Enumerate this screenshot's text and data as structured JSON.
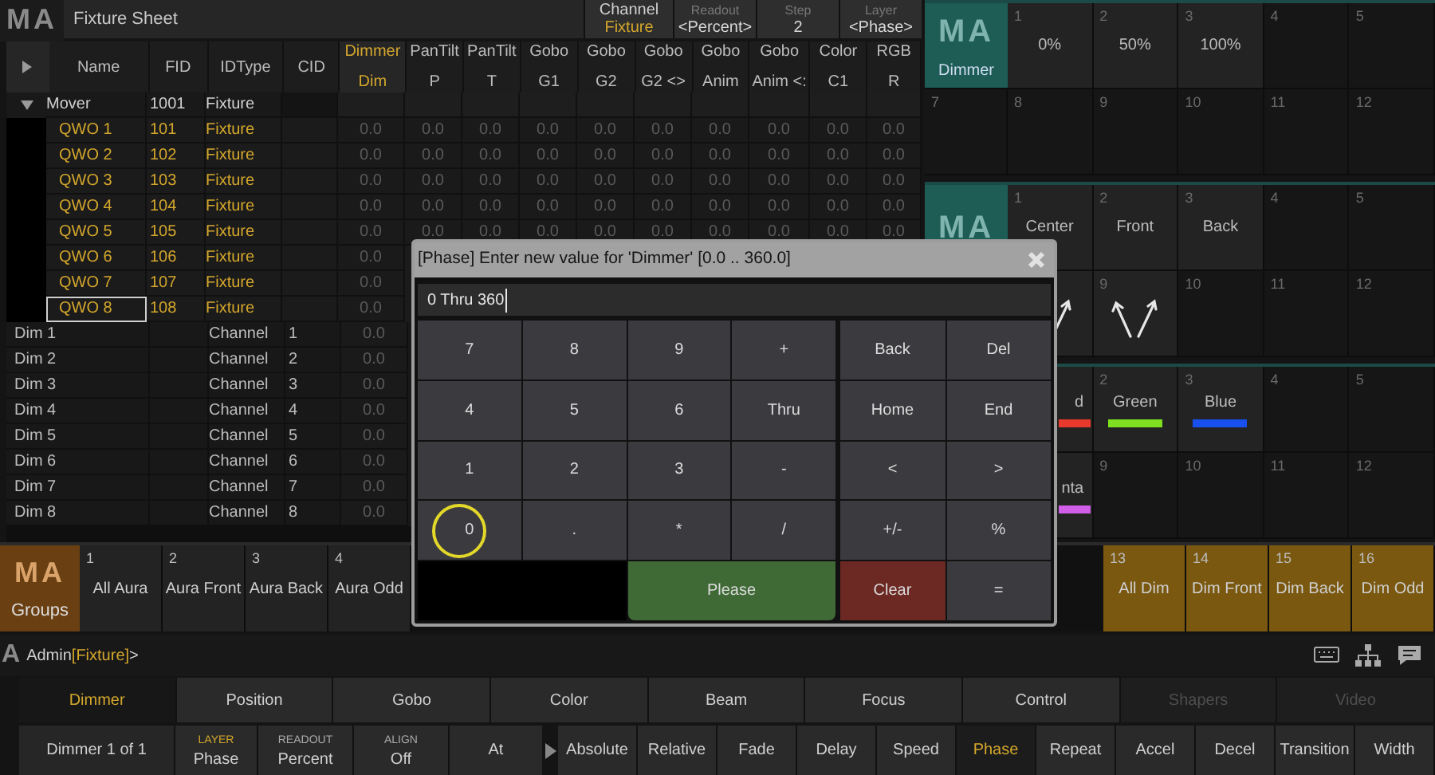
{
  "sheet": {
    "logo": "MA",
    "title": "Fixture Sheet",
    "header_fields": [
      {
        "kind": "mode",
        "label": "Channel",
        "value": "Fixture"
      },
      {
        "kind": "field",
        "label": "Readout",
        "value": "<Percent>"
      },
      {
        "kind": "field",
        "label": "Step",
        "value": "2"
      },
      {
        "kind": "field",
        "label": "Layer",
        "value": "<Phase>"
      }
    ],
    "table": {
      "columns": [
        {
          "title": "Name",
          "selected": false
        },
        {
          "title": "FID",
          "selected": false
        },
        {
          "title": "IDType",
          "selected": false
        },
        {
          "title": "CID",
          "selected": false
        },
        {
          "title": "Dimmer",
          "attribute": "Dim",
          "selected": true
        },
        {
          "title": "PanTilt",
          "attribute": "P",
          "selected": false
        },
        {
          "title": "PanTilt",
          "attribute": "T",
          "selected": false
        },
        {
          "title": "Gobo",
          "attribute": "G1",
          "selected": false
        },
        {
          "title": "Gobo",
          "attribute": "G2",
          "selected": false
        },
        {
          "title": "Gobo",
          "attribute": "G2 <>",
          "selected": false
        },
        {
          "title": "Gobo",
          "attribute": "Anim",
          "selected": false
        },
        {
          "title": "Gobo",
          "attribute": "Anim <:",
          "selected": false
        },
        {
          "title": "Color",
          "attribute": "C1",
          "selected": false
        },
        {
          "title": "RGB",
          "attribute": "R",
          "selected": false
        }
      ],
      "rows": [
        {
          "kind": "group",
          "name": "Mover",
          "fid": "1001",
          "idtype": "Fixture",
          "expanded": true
        },
        {
          "kind": "fixture",
          "name": "QWO 1",
          "fid": "101",
          "idtype": "Fixture",
          "selected": false,
          "values": [
            "0.0",
            "0.0",
            "0.0",
            "0.0",
            "0.0",
            "0.0",
            "0.0",
            "0.0",
            "0.0",
            "0.0"
          ]
        },
        {
          "kind": "fixture",
          "name": "QWO 2",
          "fid": "102",
          "idtype": "Fixture",
          "selected": false,
          "values": [
            "0.0",
            "0.0",
            "0.0",
            "0.0",
            "0.0",
            "0.0",
            "0.0",
            "0.0",
            "0.0",
            "0.0"
          ]
        },
        {
          "kind": "fixture",
          "name": "QWO 3",
          "fid": "103",
          "idtype": "Fixture",
          "selected": false,
          "values": [
            "0.0",
            "0.0",
            "0.0",
            "0.0",
            "0.0",
            "0.0",
            "0.0",
            "0.0",
            "0.0",
            "0.0"
          ]
        },
        {
          "kind": "fixture",
          "name": "QWO 4",
          "fid": "104",
          "idtype": "Fixture",
          "selected": false,
          "values": [
            "0.0",
            "0.0",
            "0.0",
            "0.0",
            "0.0",
            "0.0",
            "0.0",
            "0.0",
            "0.0",
            "0.0"
          ]
        },
        {
          "kind": "fixture",
          "name": "QWO 5",
          "fid": "105",
          "idtype": "Fixture",
          "selected": false,
          "values": [
            "0.0",
            "0.0",
            "0.0",
            "0.0",
            "0.0",
            "0.0",
            "0.0",
            "0.0",
            "0.0",
            "0.0"
          ]
        },
        {
          "kind": "fixture",
          "name": "QWO 6",
          "fid": "106",
          "idtype": "Fixture",
          "selected": false,
          "values": [
            "0.0"
          ]
        },
        {
          "kind": "fixture",
          "name": "QWO 7",
          "fid": "107",
          "idtype": "Fixture",
          "selected": false,
          "values": [
            "0.0"
          ]
        },
        {
          "kind": "fixture",
          "name": "QWO 8",
          "fid": "108",
          "idtype": "Fixture",
          "selected": true,
          "values": [
            "0.0"
          ]
        },
        {
          "kind": "channel",
          "name": "Dim 1",
          "idtype": "Channel",
          "cid": "1",
          "selected": false,
          "values": [
            "0.0"
          ]
        },
        {
          "kind": "channel",
          "name": "Dim 2",
          "idtype": "Channel",
          "cid": "2",
          "selected": false,
          "values": [
            "0.0"
          ]
        },
        {
          "kind": "channel",
          "name": "Dim 3",
          "idtype": "Channel",
          "cid": "3",
          "selected": false,
          "values": [
            "0.0"
          ]
        },
        {
          "kind": "channel",
          "name": "Dim 4",
          "idtype": "Channel",
          "cid": "4",
          "selected": false,
          "values": [
            "0.0"
          ]
        },
        {
          "kind": "channel",
          "name": "Dim 5",
          "idtype": "Channel",
          "cid": "5",
          "selected": false,
          "values": [
            "0.0"
          ]
        },
        {
          "kind": "channel",
          "name": "Dim 6",
          "idtype": "Channel",
          "cid": "6",
          "selected": false,
          "values": [
            "0.0"
          ]
        },
        {
          "kind": "channel",
          "name": "Dim 7",
          "idtype": "Channel",
          "cid": "7",
          "selected": false,
          "values": [
            "0.0"
          ]
        },
        {
          "kind": "channel",
          "name": "Dim 8",
          "idtype": "Channel",
          "cid": "8",
          "selected": false,
          "values": [
            "0.0"
          ]
        }
      ]
    }
  },
  "pools": [
    {
      "logo": "MA",
      "label": "Dimmer",
      "items": [
        {
          "kind": "preset",
          "number": "1",
          "label": "0%"
        },
        {
          "kind": "preset",
          "number": "2",
          "label": "50%"
        },
        {
          "kind": "preset",
          "number": "3",
          "label": "100%"
        },
        {
          "kind": "empty",
          "number": "4"
        },
        {
          "kind": "empty",
          "number": "5"
        },
        {
          "kind": "empty",
          "number": "7"
        },
        {
          "kind": "empty",
          "number": "8"
        },
        {
          "kind": "empty",
          "number": "9"
        },
        {
          "kind": "empty",
          "number": "10"
        },
        {
          "kind": "empty",
          "number": "11"
        },
        {
          "kind": "empty",
          "number": "12"
        }
      ]
    },
    {
      "logo": "MA",
      "items": [
        {
          "kind": "preset",
          "number": "1",
          "label": "Center"
        },
        {
          "kind": "preset",
          "number": "2",
          "label": "Front"
        },
        {
          "kind": "preset",
          "number": "3",
          "label": "Back"
        },
        {
          "kind": "empty",
          "number": "4"
        },
        {
          "kind": "empty",
          "number": "5"
        },
        {
          "kind": "covered"
        },
        {
          "kind": "arrows"
        },
        {
          "kind": "arrows",
          "number": "9"
        },
        {
          "kind": "empty",
          "number": "10"
        },
        {
          "kind": "empty",
          "number": "11"
        },
        {
          "kind": "empty",
          "number": "12"
        }
      ]
    },
    {
      "items": [
        {
          "kind": "color_clipped",
          "label": "d",
          "color": "#e8392c"
        },
        {
          "kind": "color",
          "number": "2",
          "label": "Green",
          "color": "#7ee021"
        },
        {
          "kind": "color",
          "number": "3",
          "label": "Blue",
          "color": "#1750ee"
        },
        {
          "kind": "empty",
          "number": "4"
        },
        {
          "kind": "empty",
          "number": "5"
        },
        {
          "kind": "covered"
        },
        {
          "kind": "color_clipped",
          "label": "nta",
          "color": "#d05ee8"
        },
        {
          "kind": "empty",
          "number": "9"
        },
        {
          "kind": "empty",
          "number": "10"
        },
        {
          "kind": "empty",
          "number": "11"
        },
        {
          "kind": "empty",
          "number": "12"
        }
      ]
    }
  ],
  "groups": {
    "logo": "MA",
    "label": "Groups",
    "left": [
      {
        "number": "1",
        "label": "All Aura",
        "selected": false
      },
      {
        "number": "2",
        "label": "Aura Front",
        "selected": false
      },
      {
        "number": "3",
        "label": "Aura Back",
        "selected": false
      },
      {
        "number": "4",
        "label": "Aura Odd",
        "selected": false
      }
    ],
    "right": [
      {
        "number": "13",
        "label": "All Dim",
        "selected": true
      },
      {
        "number": "14",
        "label": "Dim Front",
        "selected": true
      },
      {
        "number": "15",
        "label": "Dim Back",
        "selected": true
      },
      {
        "number": "16",
        "label": "Dim Odd",
        "selected": true
      }
    ]
  },
  "command_line": {
    "logo": "A",
    "user": "Admin",
    "context": "[Fixture]",
    "suffix": ">"
  },
  "feature_tabs": [
    {
      "label": "Dimmer",
      "selected": true,
      "disabled": false
    },
    {
      "label": "Position",
      "selected": false,
      "disabled": false
    },
    {
      "label": "Gobo",
      "selected": false,
      "disabled": false
    },
    {
      "label": "Color",
      "selected": false,
      "disabled": false
    },
    {
      "label": "Beam",
      "selected": false,
      "disabled": false
    },
    {
      "label": "Focus",
      "selected": false,
      "disabled": false
    },
    {
      "label": "Control",
      "selected": false,
      "disabled": false
    },
    {
      "label": "Shapers",
      "selected": false,
      "disabled": true
    },
    {
      "label": "Video",
      "selected": false,
      "disabled": true
    }
  ],
  "encoder_bar": {
    "feature": "Dimmer 1 of 1",
    "settings": [
      {
        "label": "LAYER",
        "value": "Phase"
      },
      {
        "label": "READOUT",
        "value": "Percent"
      },
      {
        "label": "ALIGN",
        "value": "Off"
      }
    ],
    "at": "At",
    "layers": [
      {
        "label": "Absolute",
        "selected": false
      },
      {
        "label": "Relative",
        "selected": false
      },
      {
        "label": "Fade",
        "selected": false
      },
      {
        "label": "Delay",
        "selected": false
      },
      {
        "label": "Speed",
        "selected": false
      },
      {
        "label": "Phase",
        "selected": true
      },
      {
        "label": "Repeat",
        "selected": false
      },
      {
        "label": "Accel",
        "selected": false
      },
      {
        "label": "Decel",
        "selected": false
      },
      {
        "label": "Transition",
        "selected": false
      },
      {
        "label": "Width",
        "selected": false
      }
    ]
  },
  "dialog": {
    "title": "[Phase] Enter new value for 'Dimmer' [0.0 .. 360.0]",
    "value": "0 Thru 360",
    "keypad": [
      {
        "label": "7",
        "touched": false
      },
      {
        "label": "8",
        "touched": false
      },
      {
        "label": "9",
        "touched": false
      },
      {
        "label": "+",
        "touched": false
      },
      {
        "label": "4",
        "touched": false
      },
      {
        "label": "5",
        "touched": false
      },
      {
        "label": "6",
        "touched": false
      },
      {
        "label": "Thru",
        "touched": false
      },
      {
        "label": "1",
        "touched": false
      },
      {
        "label": "2",
        "touched": false
      },
      {
        "label": "3",
        "touched": false
      },
      {
        "label": "-",
        "touched": false
      },
      {
        "label": "0",
        "touched": true
      },
      {
        "label": ".",
        "touched": false
      },
      {
        "label": "*",
        "touched": false
      },
      {
        "label": "/",
        "touched": false
      }
    ],
    "confirm": "Please",
    "edit_keys": [
      "Back",
      "Del",
      "Home",
      "End",
      "<",
      ">",
      "+/-",
      "%"
    ],
    "clear": "Clear",
    "equals": "="
  }
}
